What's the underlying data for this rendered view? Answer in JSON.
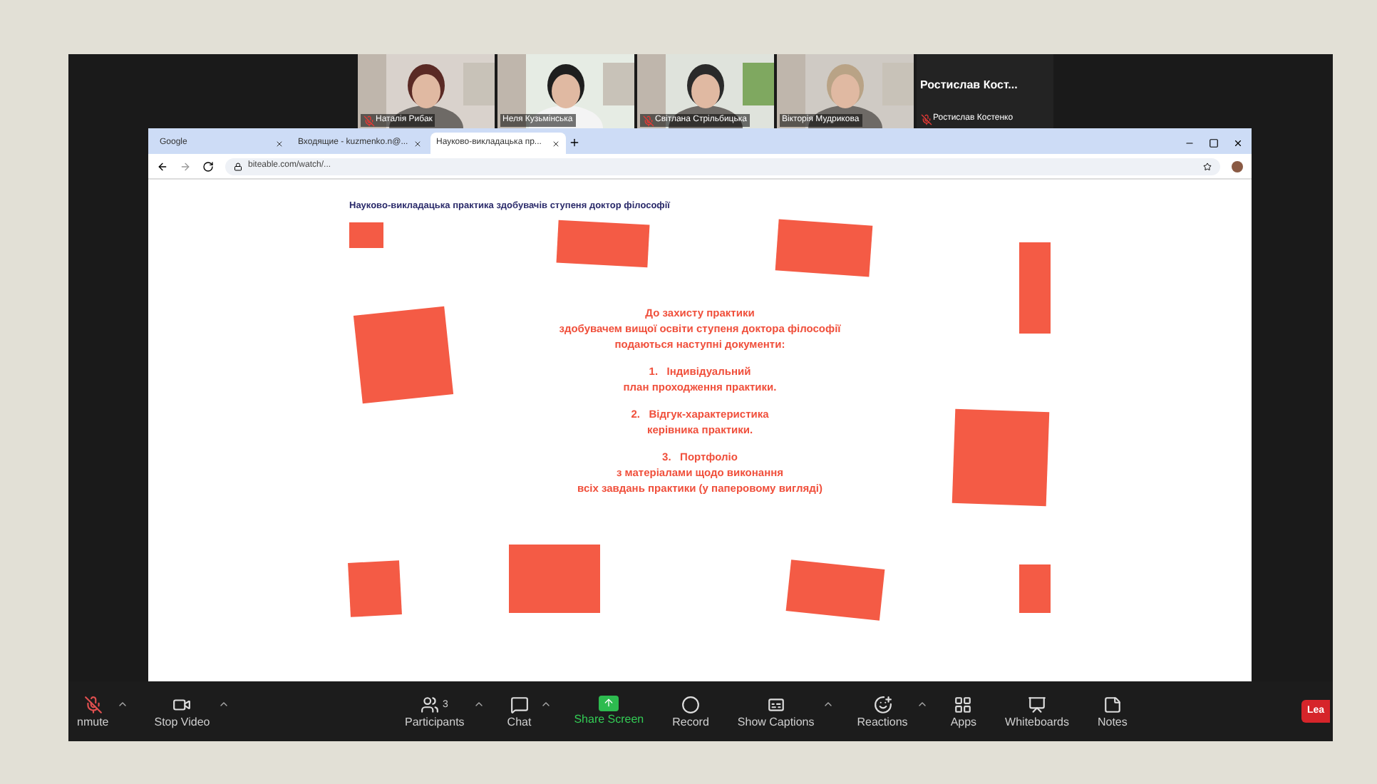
{
  "participants": [
    {
      "kind": "video",
      "name": "Наталія Рибак",
      "muted": true
    },
    {
      "kind": "video",
      "name": "Неля Кузьмінська",
      "muted": false
    },
    {
      "kind": "video",
      "name": "Світлана Стрільбицька",
      "muted": true
    },
    {
      "kind": "video",
      "name": "Вікторія Мудрикова",
      "muted": false
    },
    {
      "kind": "name",
      "display": "Ростислав  Кост...",
      "name": "Ростислав Костенко",
      "muted": true
    }
  ],
  "browser": {
    "tabs": [
      {
        "label": "Google",
        "selected": false
      },
      {
        "label": "Входящие - kuzmenko.n@...",
        "selected": false
      },
      {
        "label": "Науково-викладацька пр...",
        "selected": true
      }
    ],
    "url": "biteable.com/watch/..."
  },
  "slide": {
    "title": "Науково-викладацька практика здобувачів ступеня доктор філософії",
    "heading": [
      "До захисту практики",
      "здобувачем вищої освіти ступеня доктора філософії",
      "подаються наступні документи:"
    ],
    "items": [
      {
        "number": "1.",
        "lines": [
          "Індивідуальний",
          "план проходження практики."
        ]
      },
      {
        "number": "2.",
        "lines": [
          "Відгук-характеристика",
          "керівника практики."
        ]
      },
      {
        "number": "3.",
        "lines": [
          "Портфоліо",
          "з матеріалами щодо виконання",
          "всіх завдань практики (у паперовому вигляді)"
        ]
      }
    ]
  },
  "toolbar": {
    "left": [
      {
        "kind": "mic",
        "label": "nmute",
        "caret": true
      },
      {
        "kind": "video",
        "label": "Stop Video",
        "caret": true
      }
    ],
    "center": [
      {
        "kind": "participants",
        "label": "Participants",
        "count": "3",
        "caret": true,
        "highlighted": false
      },
      {
        "kind": "chat",
        "label": "Chat",
        "caret": true,
        "highlighted": false
      },
      {
        "kind": "share",
        "label": "Share Screen",
        "caret": false,
        "highlighted": true
      },
      {
        "kind": "record",
        "label": "Record",
        "caret": false,
        "highlighted": false
      },
      {
        "kind": "captions",
        "label": "Show Captions",
        "caret": true,
        "highlighted": false
      },
      {
        "kind": "reactions",
        "label": "Reactions",
        "caret": true,
        "highlighted": false
      },
      {
        "kind": "apps",
        "label": "Apps",
        "caret": false,
        "highlighted": false
      },
      {
        "kind": "whiteboards",
        "label": "Whiteboards",
        "caret": false,
        "highlighted": false
      },
      {
        "kind": "notes",
        "label": "Notes",
        "caret": false,
        "highlighted": false
      }
    ],
    "leave": "Lea"
  }
}
